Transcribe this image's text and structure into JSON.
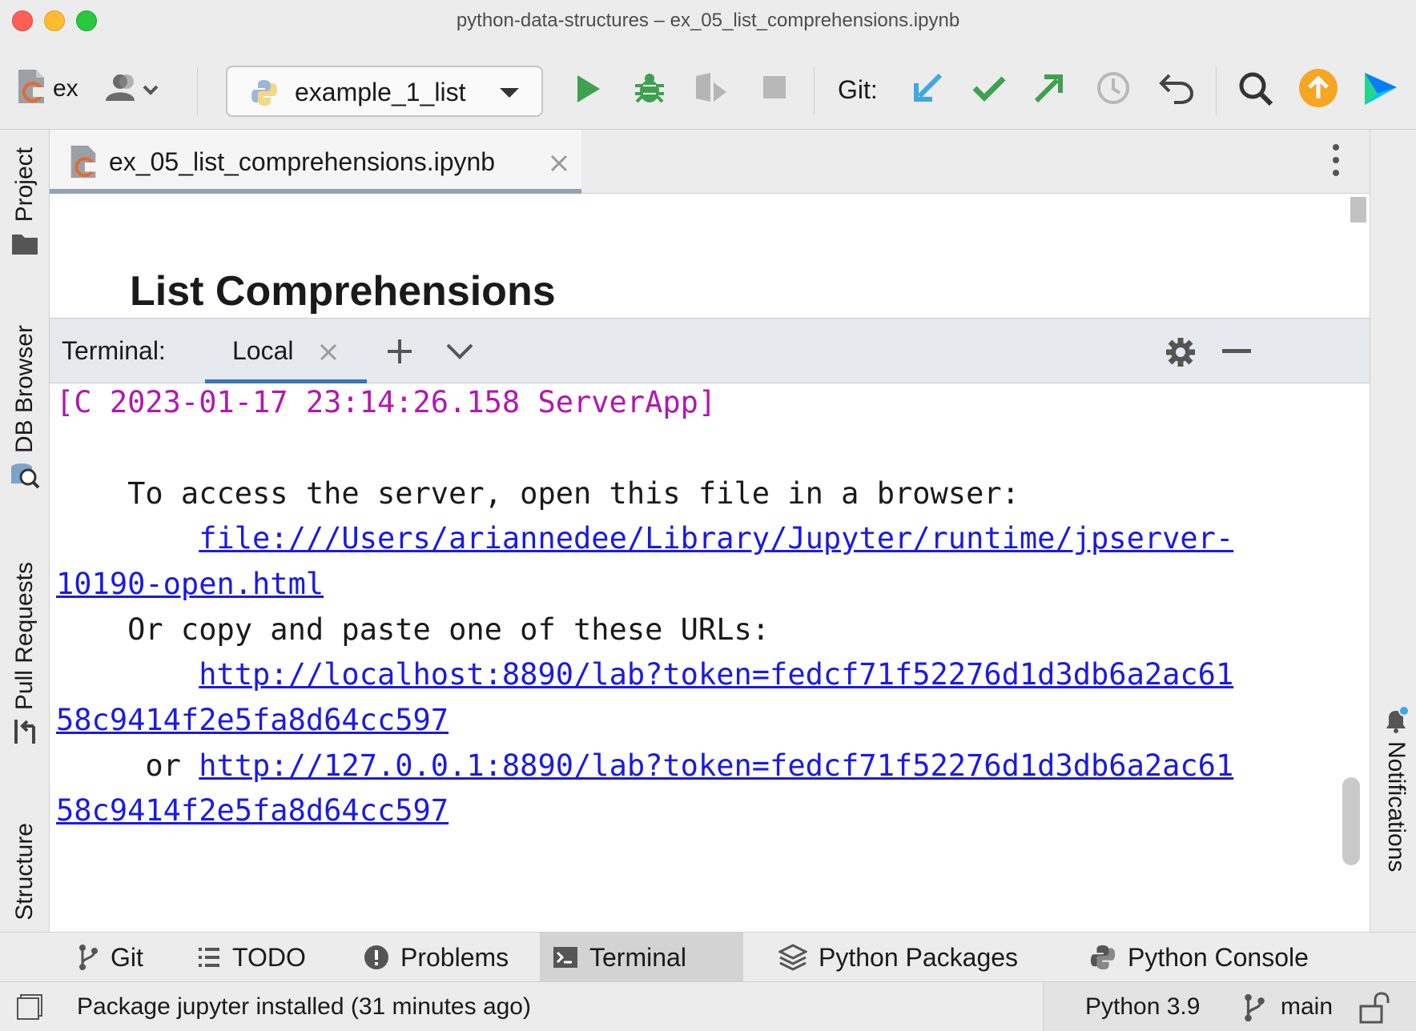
{
  "window": {
    "title": "python-data-structures – ex_05_list_comprehensions.ipynb"
  },
  "toolbar": {
    "project_name": "ex",
    "run_config": "example_1_list",
    "git_label": "Git:",
    "icons": [
      "project-icon",
      "user-icon",
      "python-icon",
      "run-icon",
      "debug-icon",
      "coverage-icon",
      "stop-icon",
      "git-update-icon",
      "git-commit-icon",
      "git-push-icon",
      "history-icon",
      "revert-icon",
      "search-icon",
      "update-icon",
      "jetbrains-logo-icon"
    ],
    "colors": {
      "run": "#3ea150",
      "git_update": "#3ea8e0",
      "git_commit": "#3ea150",
      "git_push": "#3ea150",
      "update_badge": "#f5a623"
    }
  },
  "left_sidebar": {
    "tabs": [
      {
        "label": "Project"
      },
      {
        "label": "DB Browser"
      },
      {
        "label": "Pull Requests"
      },
      {
        "label": "Structure"
      }
    ]
  },
  "right_sidebar": {
    "tabs": [
      {
        "label": "Notifications"
      }
    ]
  },
  "editor": {
    "tab_label": "ex_05_list_comprehensions.ipynb",
    "heading": "List Comprehensions"
  },
  "terminal": {
    "label": "Terminal:",
    "tab": "Local",
    "lines": {
      "log": "[C 2023-01-17 23:14:26.158 ServerApp]",
      "access": "    To access the server, open this file in a browser:",
      "indent_link": "        ",
      "file_url_1": "file:///Users/ariannedee/Library/Jupyter/runtime/jpserver-",
      "file_url_2": "10190-open.html",
      "copy": "    Or copy and paste one of these URLs:",
      "url1_1": "http://localhost:8890/lab?token=fedcf71f52276d1d3db6a2ac61",
      "url1_2": "58c9414f2e5fa8d64cc597",
      "or_prefix": "     or ",
      "url2_1": "http://127.0.0.1:8890/lab?token=fedcf71f52276d1d3db6a2ac61",
      "url2_2": "58c9414f2e5fa8d64cc597"
    },
    "colors": {
      "log": "#b217b0",
      "link": "#1a1ae6"
    }
  },
  "bottom_tabs": [
    {
      "label": "Git"
    },
    {
      "label": "TODO"
    },
    {
      "label": "Problems"
    },
    {
      "label": "Terminal",
      "active": true
    },
    {
      "label": "Python Packages"
    },
    {
      "label": "Python Console"
    }
  ],
  "status": {
    "message": "Package jupyter installed (31 minutes ago)",
    "interpreter": "Python 3.9",
    "branch": "main"
  }
}
